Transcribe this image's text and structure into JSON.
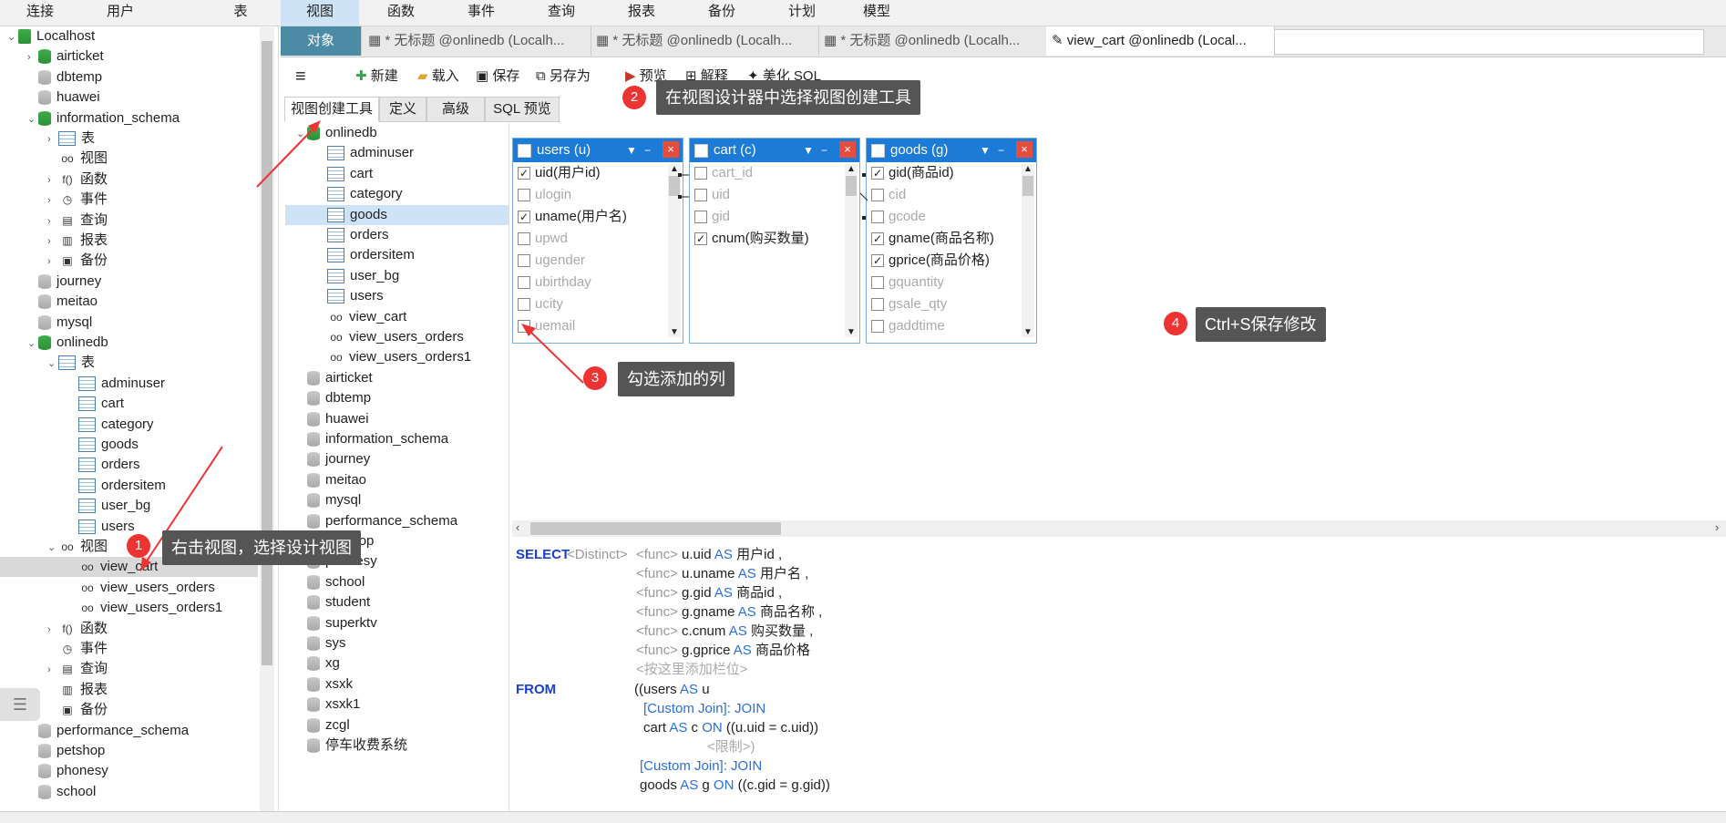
{
  "menu": [
    "连接",
    "用户",
    "表",
    "视图",
    "函数",
    "事件",
    "查询",
    "报表",
    "备份",
    "计划",
    "模型"
  ],
  "left_tree": [
    {
      "label": "Localhost",
      "icon": "server-icon",
      "arrow": "v",
      "indent": 0
    },
    {
      "label": "airticket",
      "icon": "database-green-icon",
      "arrow": ">",
      "indent": 1
    },
    {
      "label": "dbtemp",
      "icon": "database-gray-icon",
      "arrow": "",
      "indent": 1
    },
    {
      "label": "huawei",
      "icon": "database-gray-icon",
      "arrow": "",
      "indent": 1
    },
    {
      "label": "information_schema",
      "icon": "database-green-icon",
      "arrow": "v",
      "indent": 1
    },
    {
      "label": "表",
      "icon": "table-icon",
      "arrow": ">",
      "indent": 2
    },
    {
      "label": "视图",
      "icon": "view-icon",
      "arrow": "",
      "indent": 2
    },
    {
      "label": "函数",
      "icon": "function-icon",
      "arrow": ">",
      "indent": 2
    },
    {
      "label": "事件",
      "icon": "event-icon",
      "arrow": ">",
      "indent": 2
    },
    {
      "label": "查询",
      "icon": "query-icon",
      "arrow": ">",
      "indent": 2
    },
    {
      "label": "报表",
      "icon": "report-icon",
      "arrow": ">",
      "indent": 2
    },
    {
      "label": "备份",
      "icon": "backup-icon",
      "arrow": ">",
      "indent": 2
    },
    {
      "label": "journey",
      "icon": "database-gray-icon",
      "arrow": "",
      "indent": 1
    },
    {
      "label": "meitao",
      "icon": "database-gray-icon",
      "arrow": "",
      "indent": 1
    },
    {
      "label": "mysql",
      "icon": "database-gray-icon",
      "arrow": "",
      "indent": 1
    },
    {
      "label": "onlinedb",
      "icon": "database-green-icon",
      "arrow": "v",
      "indent": 1
    },
    {
      "label": "表",
      "icon": "table-icon",
      "arrow": "v",
      "indent": 2
    },
    {
      "label": "adminuser",
      "icon": "table-icon",
      "arrow": "",
      "indent": 3
    },
    {
      "label": "cart",
      "icon": "table-icon",
      "arrow": "",
      "indent": 3
    },
    {
      "label": "category",
      "icon": "table-icon",
      "arrow": "",
      "indent": 3
    },
    {
      "label": "goods",
      "icon": "table-icon",
      "arrow": "",
      "indent": 3
    },
    {
      "label": "orders",
      "icon": "table-icon",
      "arrow": "",
      "indent": 3
    },
    {
      "label": "ordersitem",
      "icon": "table-icon",
      "arrow": "",
      "indent": 3
    },
    {
      "label": "user_bg",
      "icon": "table-icon",
      "arrow": "",
      "indent": 3
    },
    {
      "label": "users",
      "icon": "table-icon",
      "arrow": "",
      "indent": 3
    },
    {
      "label": "视图",
      "icon": "view-icon",
      "arrow": "v",
      "indent": 2
    },
    {
      "label": "view_cart",
      "icon": "view-icon",
      "arrow": "",
      "indent": 3,
      "selected": true
    },
    {
      "label": "view_users_orders",
      "icon": "view-icon",
      "arrow": "",
      "indent": 3
    },
    {
      "label": "view_users_orders1",
      "icon": "view-icon",
      "arrow": "",
      "indent": 3
    },
    {
      "label": "函数",
      "icon": "function-icon",
      "arrow": ">",
      "indent": 2
    },
    {
      "label": "事件",
      "icon": "event-icon",
      "arrow": "",
      "indent": 2
    },
    {
      "label": "查询",
      "icon": "query-icon",
      "arrow": ">",
      "indent": 2
    },
    {
      "label": "报表",
      "icon": "report-icon",
      "arrow": "",
      "indent": 2
    },
    {
      "label": "备份",
      "icon": "backup-icon",
      "arrow": "",
      "indent": 2
    },
    {
      "label": "performance_schema",
      "icon": "database-gray-icon",
      "arrow": "",
      "indent": 1
    },
    {
      "label": "petshop",
      "icon": "database-gray-icon",
      "arrow": "",
      "indent": 1
    },
    {
      "label": "phonesy",
      "icon": "database-gray-icon",
      "arrow": "",
      "indent": 1
    },
    {
      "label": "school",
      "icon": "database-gray-icon",
      "arrow": "",
      "indent": 1
    }
  ],
  "tabs": {
    "object": "对象",
    "items": [
      "* 无标题 @onlinedb (Localh...",
      "* 无标题 @onlinedb (Localh...",
      "* 无标题 @onlinedb (Localh...",
      "view_cart @onlinedb (Local..."
    ]
  },
  "toolbar": {
    "menu_icon": "≡",
    "new": "新建",
    "load": "载入",
    "save": "保存",
    "save_as": "另存为",
    "preview": "预览",
    "explain": "解释",
    "beautify": "美化 SQL"
  },
  "subtabs": [
    "视图创建工具",
    "定义",
    "高级",
    "SQL 预览"
  ],
  "mid_tree": [
    {
      "label": "onlinedb",
      "icon": "database-green-icon",
      "arrow": "v",
      "indent": 0
    },
    {
      "label": "adminuser",
      "icon": "table-icon",
      "indent": 1
    },
    {
      "label": "cart",
      "icon": "table-icon",
      "indent": 1
    },
    {
      "label": "category",
      "icon": "table-icon",
      "indent": 1
    },
    {
      "label": "goods",
      "icon": "table-icon",
      "indent": 1,
      "selected": true
    },
    {
      "label": "orders",
      "icon": "table-icon",
      "indent": 1
    },
    {
      "label": "ordersitem",
      "icon": "table-icon",
      "indent": 1
    },
    {
      "label": "user_bg",
      "icon": "table-icon",
      "indent": 1
    },
    {
      "label": "users",
      "icon": "table-icon",
      "indent": 1
    },
    {
      "label": "view_cart",
      "icon": "view-icon",
      "indent": 1
    },
    {
      "label": "view_users_orders",
      "icon": "view-icon",
      "indent": 1
    },
    {
      "label": "view_users_orders1",
      "icon": "view-icon",
      "indent": 1
    },
    {
      "label": "airticket",
      "icon": "database-gray-icon",
      "indent": 0
    },
    {
      "label": "dbtemp",
      "icon": "database-gray-icon",
      "indent": 0
    },
    {
      "label": "huawei",
      "icon": "database-gray-icon",
      "indent": 0
    },
    {
      "label": "information_schema",
      "icon": "database-gray-icon",
      "indent": 0
    },
    {
      "label": "journey",
      "icon": "database-gray-icon",
      "indent": 0
    },
    {
      "label": "meitao",
      "icon": "database-gray-icon",
      "indent": 0
    },
    {
      "label": "mysql",
      "icon": "database-gray-icon",
      "indent": 0
    },
    {
      "label": "performance_schema",
      "icon": "database-gray-icon",
      "indent": 0
    },
    {
      "label": "petshop",
      "icon": "database-gray-icon",
      "indent": 0
    },
    {
      "label": "phonesy",
      "icon": "database-gray-icon",
      "indent": 0
    },
    {
      "label": "school",
      "icon": "database-gray-icon",
      "indent": 0
    },
    {
      "label": "student",
      "icon": "database-gray-icon",
      "indent": 0
    },
    {
      "label": "superktv",
      "icon": "database-gray-icon",
      "indent": 0
    },
    {
      "label": "sys",
      "icon": "database-gray-icon",
      "indent": 0
    },
    {
      "label": "xg",
      "icon": "database-gray-icon",
      "indent": 0
    },
    {
      "label": "xsxk",
      "icon": "database-gray-icon",
      "indent": 0
    },
    {
      "label": "xsxk1",
      "icon": "database-gray-icon",
      "indent": 0
    },
    {
      "label": "zcgl",
      "icon": "database-gray-icon",
      "indent": 0
    },
    {
      "label": "停车收费系统",
      "icon": "database-gray-icon",
      "indent": 0
    }
  ],
  "designer_tables": [
    {
      "title": "users (u)",
      "columns": [
        {
          "name": "uid(用户id)",
          "checked": true
        },
        {
          "name": "ulogin",
          "checked": false
        },
        {
          "name": "uname(用户名)",
          "checked": true
        },
        {
          "name": "upwd",
          "checked": false
        },
        {
          "name": "ugender",
          "checked": false
        },
        {
          "name": "ubirthday",
          "checked": false
        },
        {
          "name": "ucity",
          "checked": false
        },
        {
          "name": "uemail",
          "checked": false
        }
      ]
    },
    {
      "title": "cart (c)",
      "columns": [
        {
          "name": "cart_id",
          "checked": false
        },
        {
          "name": "uid",
          "checked": false
        },
        {
          "name": "gid",
          "checked": false
        },
        {
          "name": "cnum(购买数量)",
          "checked": true
        }
      ]
    },
    {
      "title": "goods (g)",
      "columns": [
        {
          "name": "gid(商品id)",
          "checked": true
        },
        {
          "name": "cid",
          "checked": false
        },
        {
          "name": "gcode",
          "checked": false
        },
        {
          "name": "gname(商品名称)",
          "checked": true
        },
        {
          "name": "gprice(商品价格)",
          "checked": true
        },
        {
          "name": "gquantity",
          "checked": false
        },
        {
          "name": "gsale_qty",
          "checked": false
        },
        {
          "name": "gaddtime",
          "checked": false
        }
      ]
    }
  ],
  "sql": {
    "select": "SELECT",
    "distinct": "<Distinct>",
    "func": "<func>",
    "as": "AS",
    "fields": [
      {
        "expr": "u.uid",
        "alias": "用户id ,"
      },
      {
        "expr": "u.uname",
        "alias": "用户名 ,"
      },
      {
        "expr": "g.gid",
        "alias": "商品id ,"
      },
      {
        "expr": "g.gname",
        "alias": "商品名称 ,"
      },
      {
        "expr": "c.cnum",
        "alias": "购买数量 ,"
      },
      {
        "expr": "g.gprice",
        "alias": "商品价格"
      }
    ],
    "add_field": "<按这里添加栏位>",
    "from": "FROM",
    "from_line": "((users",
    "from_alias": "u",
    "custom_join": "[Custom Join]: JOIN",
    "join1_table": "cart",
    "join1_alias": "c",
    "on": "ON",
    "join1_cond": "((u.uid = c.uid))",
    "limit": "<限制>)",
    "join2_table": "goods",
    "join2_alias": "g",
    "join2_cond": "((c.gid = g.gid))"
  },
  "callouts": [
    {
      "num": "1",
      "text": "右击视图，选择设计视图"
    },
    {
      "num": "2",
      "text": "在视图设计器中选择视图创建工具"
    },
    {
      "num": "3",
      "text": "勾选添加的列"
    },
    {
      "num": "4",
      "text": "Ctrl+S保存修改"
    }
  ],
  "colors": {
    "accent": "#1c7bd6",
    "callout_bg": "#555555",
    "badge": "#e33333",
    "tab_obj": "#4b8ba5"
  }
}
